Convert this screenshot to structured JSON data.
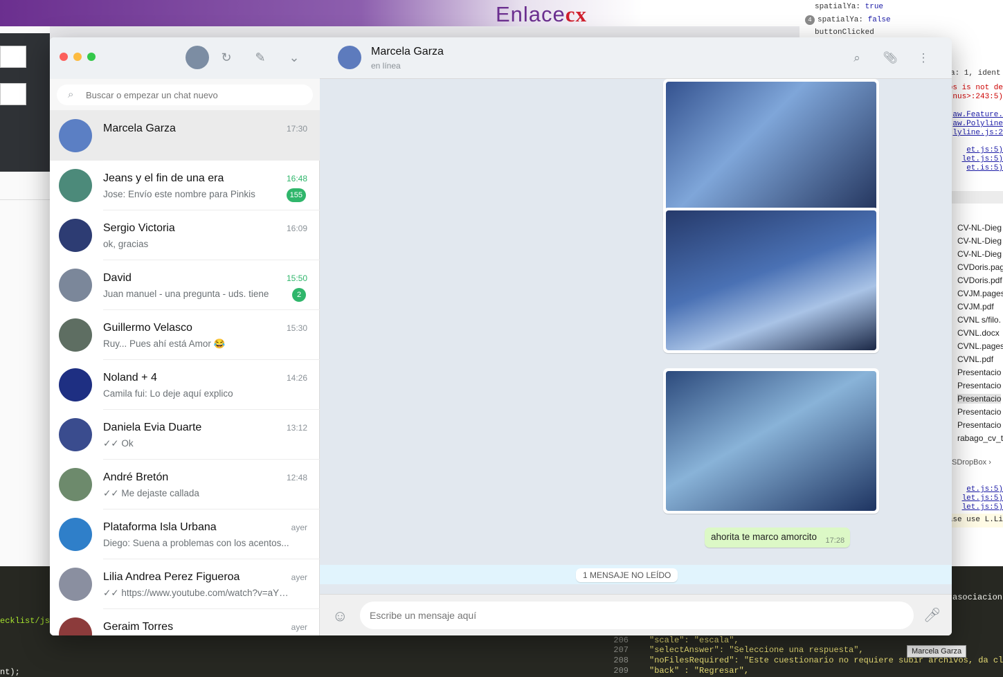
{
  "background": {
    "logo": {
      "text": "Enlace",
      "accent": "cx",
      "brand_color": "#6b2f8f",
      "accent_color": "#d0202e"
    },
    "devtools": {
      "lines": [
        {
          "prefix": "spatialYa: ",
          "value": "true"
        },
        {
          "prefix": "spatialYa: ",
          "value": "false",
          "count": "4"
        },
        {
          "prefix": "buttonClicked",
          "value": ""
        }
      ],
      "snippets": {
        "ident": "a: 1, ident",
        "err1": "os is not de",
        "err2": "nus>:243:5)",
        "link1": "aw.Feature.",
        "link2": "aw.Polyline",
        "link3": "lyline.js:2",
        "link4": "et.js:5)",
        "link5": "let.js:5)",
        "link6": "et.is:5)",
        "link7": "et.js:5)",
        "link8": "let.js:5)",
        "link9": "let.js:5)",
        "warn": "ase use L.Li"
      }
    },
    "finder": {
      "items": [
        "CV-NL-Dieg",
        "CV-NL-Dieg",
        "CV-NL-Dieg",
        "CVDoris.pag",
        "CVDoris.pdf",
        "CVJM.pages",
        "CVJM.pdf",
        "CVNL s/filo.",
        "CVNL.docx",
        "CVNL.pages",
        "CVNL.pdf",
        "Presentacio",
        "Presentacio",
        "Presentacio",
        "Presentacio",
        "Presentacio",
        "rabago_cv_t"
      ],
      "path": "SDropBox ›"
    },
    "editor_left": {
      "line1": "ecklist/js",
      "line2": "nt);"
    },
    "editor_right": {
      "top_word": "asociacion",
      "lines": [
        {
          "num": "206",
          "text": "\"scale\": \"escala\","
        },
        {
          "num": "207",
          "text": "\"selectAnswer\": \"Seleccione una respuesta\","
        },
        {
          "num": "208",
          "text": "\"noFilesRequired\": \"Este cuestionario no requiere subir archivos, da cli"
        },
        {
          "num": "209",
          "text": "\"back\" : \"Regresar\","
        }
      ]
    },
    "tooltip": "Marcela Garza"
  },
  "sidebar": {
    "icons": [
      "status-icon",
      "new-chat-icon",
      "menu-icon"
    ],
    "search": {
      "placeholder": "Buscar o empezar un chat nuevo",
      "value": ""
    },
    "chats": [
      {
        "name": "Marcela Garza",
        "time": "17:30",
        "preview": "",
        "badge": "",
        "unread": false,
        "active": true,
        "color": "#5b7fc4"
      },
      {
        "name": "Jeans y el fin de una era",
        "time": "16:48",
        "preview": "Jose: Envío este nombre para Pinkis",
        "badge": "155",
        "unread": true,
        "active": false,
        "color": "#4c8a7a"
      },
      {
        "name": "Sergio Victoria",
        "time": "16:09",
        "preview": "ok, gracias",
        "badge": "",
        "unread": false,
        "active": false,
        "color": "#2d3c73"
      },
      {
        "name": "David",
        "time": "15:50",
        "preview": "Juan manuel - una pregunta - uds. tiene",
        "badge": "2",
        "unread": true,
        "active": false,
        "color": "#7b879a"
      },
      {
        "name": "Guillermo Velasco",
        "time": "15:30",
        "preview": "Ruy... Pues ahí está Amor 😂",
        "badge": "",
        "unread": false,
        "active": false,
        "color": "#5e6e62"
      },
      {
        "name": "Noland + 4",
        "time": "14:26",
        "preview": "Camila fui: Lo deje aquí explico",
        "badge": "",
        "unread": false,
        "active": false,
        "color": "#1e2f82"
      },
      {
        "name": "Daniela Evia Duarte",
        "time": "13:12",
        "preview": "✓✓ Ok",
        "badge": "",
        "unread": false,
        "active": false,
        "color": "#3a4c8e"
      },
      {
        "name": "André Bretón",
        "time": "12:48",
        "preview": "✓✓ Me dejaste callada",
        "badge": "",
        "unread": false,
        "active": false,
        "color": "#6d8a6c"
      },
      {
        "name": "Plataforma Isla Urbana",
        "time": "ayer",
        "preview": "Diego: Suena a problemas con los acentos...",
        "badge": "",
        "unread": false,
        "active": false,
        "color": "#2f7fc9"
      },
      {
        "name": "Lilia Andrea Perez Figueroa",
        "time": "ayer",
        "preview": "✓✓ https://www.youtube.com/watch?v=aY8...",
        "badge": "",
        "unread": false,
        "active": false,
        "color": "#8a8fa0"
      },
      {
        "name": "Geraim Torres",
        "time": "ayer",
        "preview": "",
        "badge": "",
        "unread": false,
        "active": false,
        "color": "#8c3b3b"
      }
    ]
  },
  "conversation": {
    "name": "Marcela Garza",
    "status": "en línea",
    "header_icons": [
      "search-icon",
      "attach-icon",
      "menu-icon"
    ],
    "images": [
      {
        "time": ""
      },
      {
        "time": ""
      },
      {
        "time": ""
      }
    ],
    "text_message": {
      "text": "ahorita te marco amorcito",
      "time": "17:28"
    },
    "unread_label": "1 MENSAJE NO LEÍDO",
    "composer_placeholder": "Escribe un mensaje aquí"
  }
}
